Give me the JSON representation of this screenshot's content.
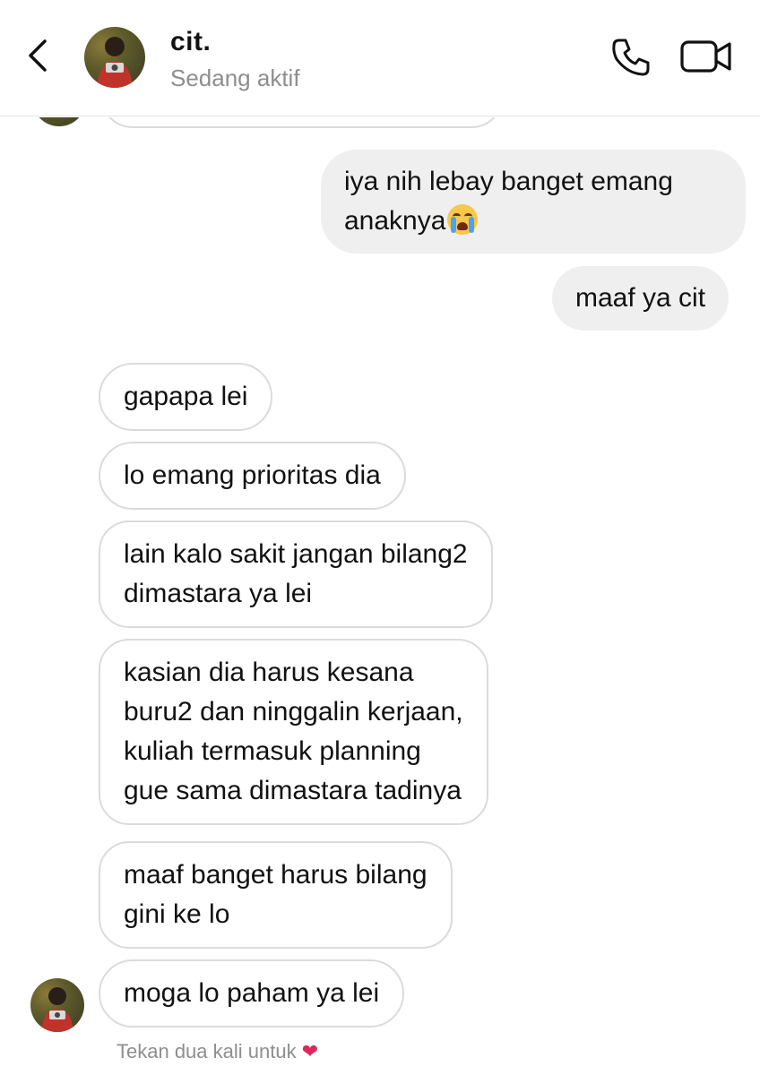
{
  "header": {
    "name": "cit.",
    "status": "Sedang aktif"
  },
  "icons": {
    "back": "chevron-left-icon",
    "call": "phone-icon",
    "video": "video-camera-icon",
    "emoji": "loudly-crying-face-emoji",
    "heart": "heart-icon"
  },
  "colors": {
    "my_bubble": "#efefef",
    "their_bubble_border": "#dbdbdb",
    "secondary_text": "#8e8e8e",
    "heart": "#e0245e"
  },
  "messages": [
    {
      "from": "me",
      "text": "iya nih lebay banget emang",
      "text2": "anaknya"
    },
    {
      "from": "me",
      "text": "maaf ya cit"
    },
    {
      "from": "them",
      "text": "gapapa lei"
    },
    {
      "from": "them",
      "text": "lo emang prioritas dia"
    },
    {
      "from": "them",
      "lines": [
        "lain kalo sakit jangan bilang2",
        "dimastara ya lei"
      ]
    },
    {
      "from": "them",
      "lines": [
        "kasian dia harus kesana",
        "buru2 dan ninggalin kerjaan,",
        "kuliah termasuk planning",
        "gue sama dimastara tadinya"
      ]
    },
    {
      "from": "them",
      "lines": [
        "maaf banget harus bilang",
        "gini ke lo"
      ]
    },
    {
      "from": "them",
      "text": "moga lo paham ya lei"
    }
  ],
  "hint": {
    "text": "Tekan dua kali untuk",
    "heart": "❤"
  }
}
